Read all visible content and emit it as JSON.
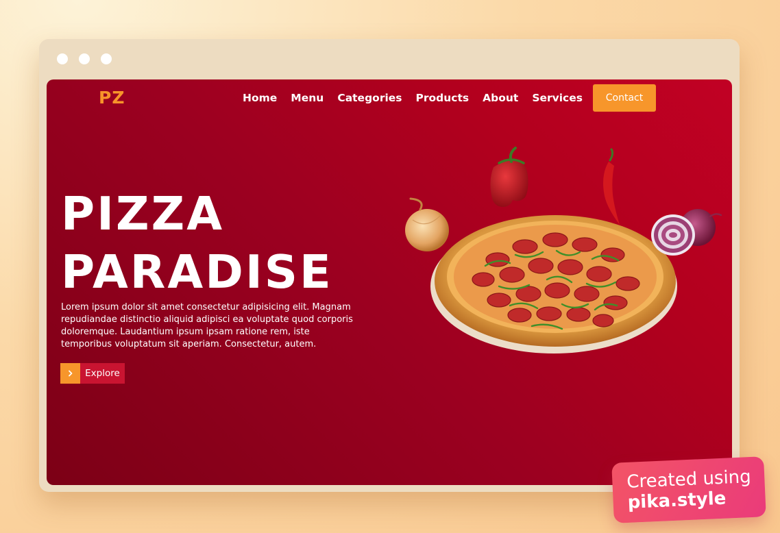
{
  "site": {
    "logo": "PZ",
    "nav": [
      "Home",
      "Menu",
      "Categories",
      "Products",
      "About",
      "Services"
    ],
    "contact_label": "Contact"
  },
  "hero": {
    "title_line1": "PIZZA",
    "title_line2": "PARADISE",
    "paragraph": "Lorem ipsum dolor sit amet consectetur adipisicing elit. Magnam repudiandae distinctio aliquid adipisci ea voluptate quod corporis doloremque. Laudantium ipsum ipsam ratione rem, iste temporibus voluptatum sit aperiam. Consectetur, autem.",
    "explore_label": "Explore",
    "explore_icon": "chevron-right-icon"
  },
  "badge": {
    "line1": "Created using",
    "line2": "pika.style"
  },
  "colors": {
    "accent": "#f7962b",
    "hero_bg_start": "#7c0016",
    "hero_bg_end": "#c10124",
    "explore_label_bg": "#c91431",
    "badge_start": "#f35466",
    "badge_end": "#ea3b7a"
  }
}
